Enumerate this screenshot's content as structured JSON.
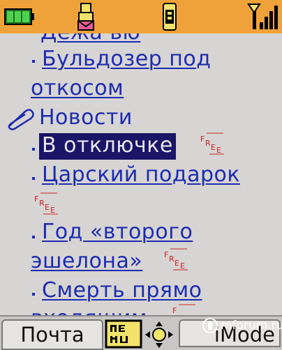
{
  "colors": {
    "status_bar": "#f0a23a",
    "link": "#1d2bb0",
    "selection": "#1a1566",
    "free_badge": "#cc2222"
  },
  "status": {
    "battery_icon": "battery-icon",
    "mail_icon": "mail-icon",
    "sim_icon": "sim-card-icon",
    "signal_icon": "signal-strength-icon"
  },
  "list": {
    "cut_top": "Дежа вю",
    "item_bulldozer_line1": "Бульдозер под",
    "item_bulldozer_line2": "откосом",
    "section_news": "Новости",
    "item_disconnected": "В отключке",
    "item_tsar_gift": "Царский подарок",
    "item_second_echelon_line1": "Год «второго",
    "item_second_echelon_line2": "эшелона»",
    "item_death_line1": "Смерть прямо",
    "item_death_line2": "входящим"
  },
  "free_badge": {
    "letters": [
      "F",
      "R",
      "E",
      "E"
    ]
  },
  "softkeys": {
    "left_label": "Почта",
    "menu_icon": "menu-icon",
    "nav_icon": "navigation-joystick-icon",
    "right_label": "iMode"
  },
  "watermark": {
    "text": "mforum.ru"
  }
}
